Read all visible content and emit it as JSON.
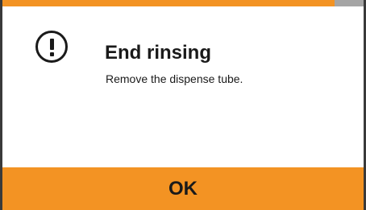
{
  "progress": {
    "fraction": 0.92,
    "fill_color": "#f39323",
    "track_color": "#a5a5a5"
  },
  "dialog": {
    "icon": "exclamation-circle-icon",
    "title": "End rinsing",
    "message": "Remove the dispense tube."
  },
  "actions": {
    "ok_label": "OK",
    "button_color": "#f39323"
  }
}
